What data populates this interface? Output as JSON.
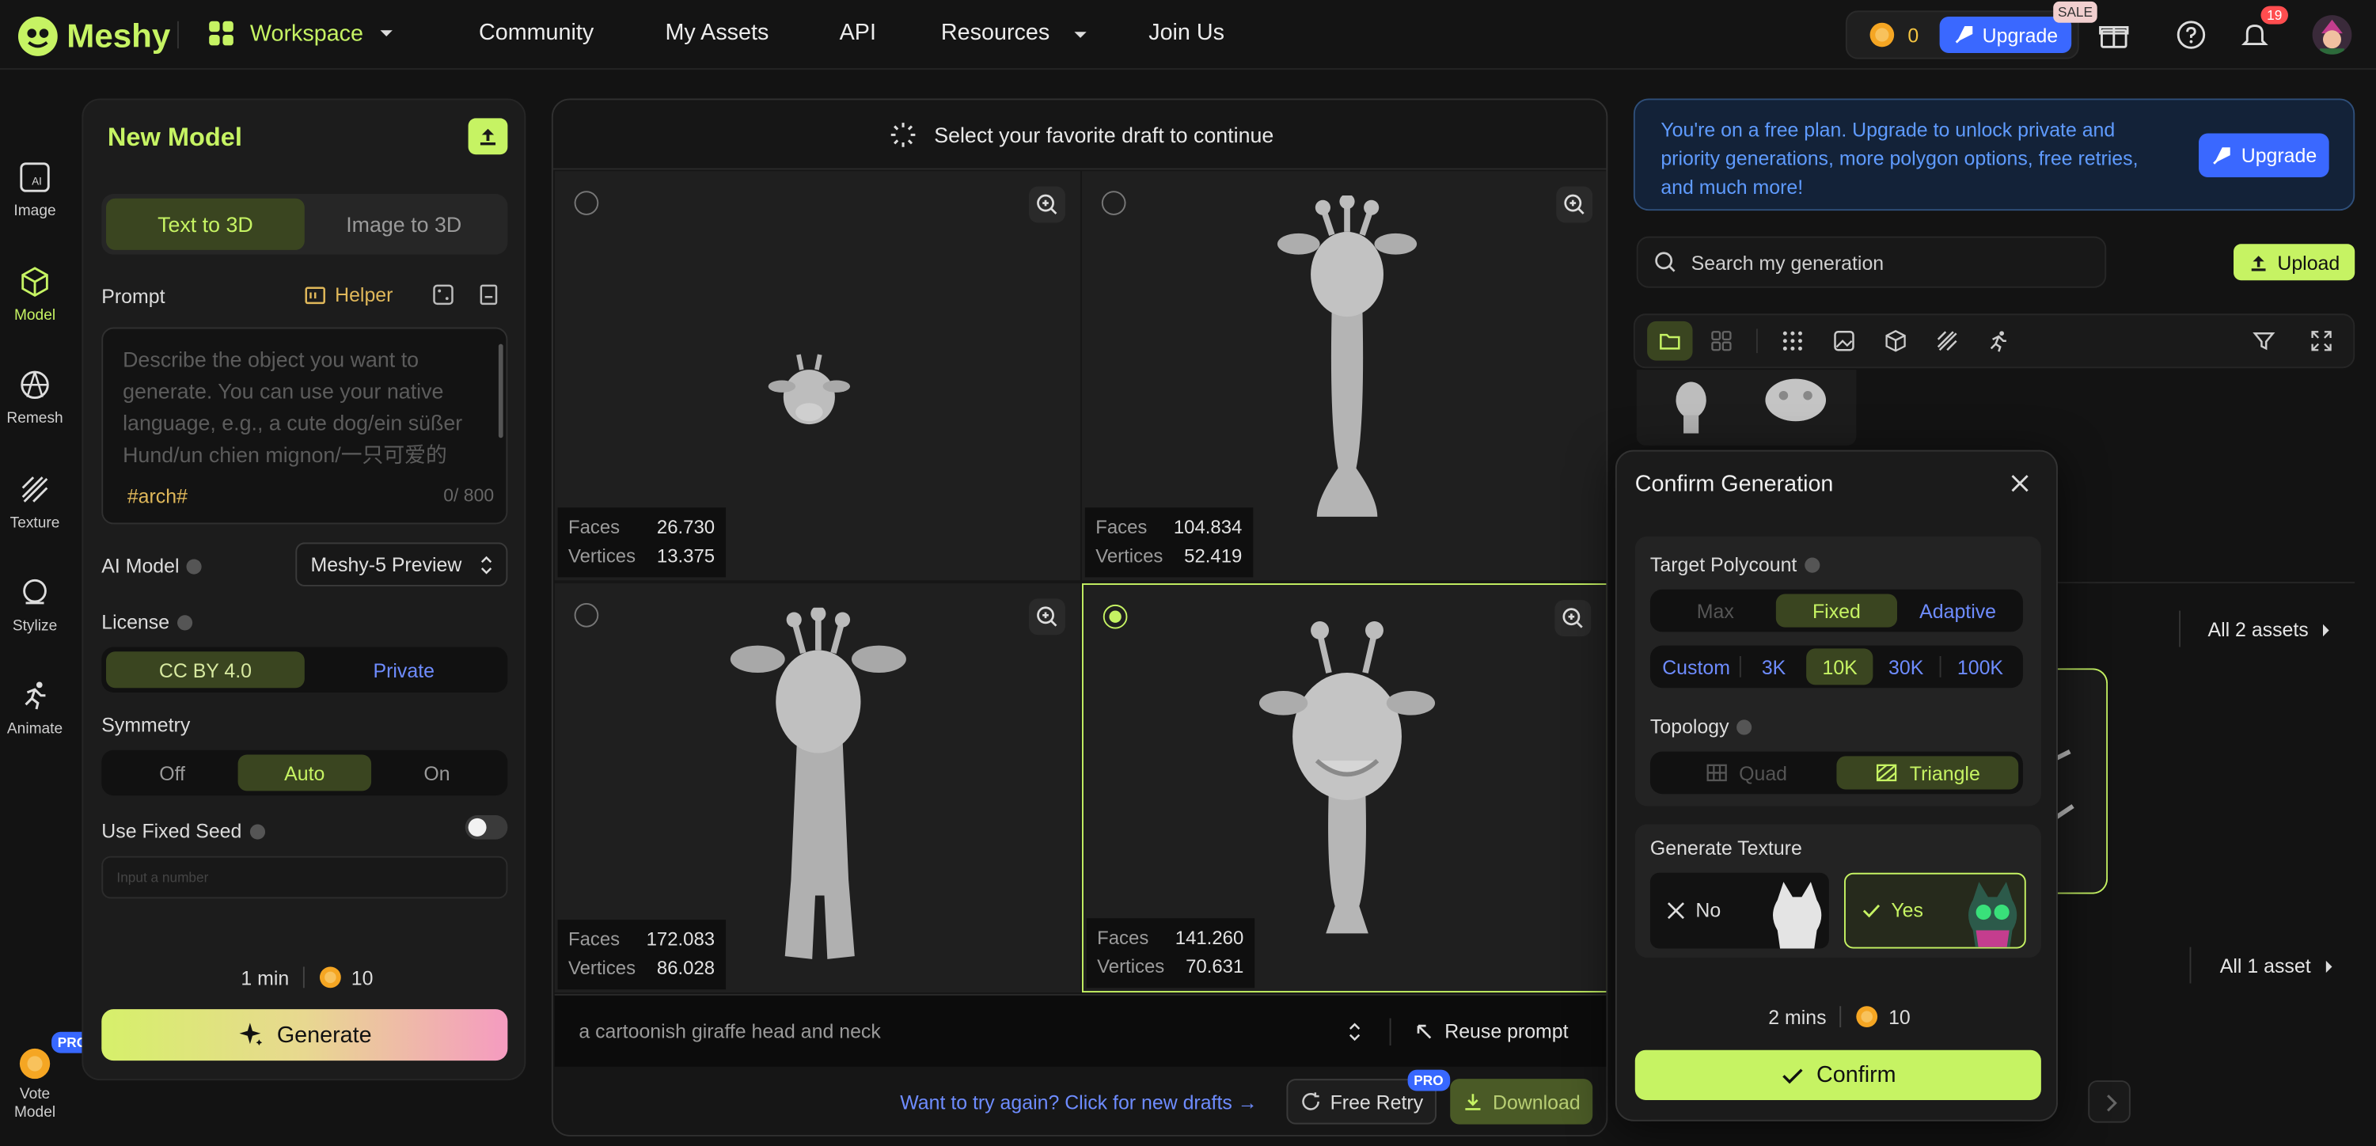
{
  "topbar": {
    "brand": "Meshy",
    "workspace": "Workspace",
    "nav": [
      "Community",
      "My Assets",
      "API",
      "Resources",
      "Join Us"
    ],
    "credits": "0",
    "upgrade": "Upgrade",
    "sale": "SALE",
    "notif_count": "19"
  },
  "sidebar": {
    "items": [
      "Image",
      "Model",
      "Remesh",
      "Texture",
      "Stylize",
      "Animate"
    ],
    "vote_line1": "Vote",
    "vote_line2": "Model",
    "pro": "PRO"
  },
  "left": {
    "title": "New Model",
    "tabs": [
      "Text to 3D",
      "Image to 3D"
    ],
    "prompt_label": "Prompt",
    "helper": "Helper",
    "placeholder": "Describe the object you want to generate. You can use your native language, e.g., a cute dog/ein süßer Hund/un chien mignon/一只可爱的",
    "tag": "#arch#",
    "count": "0/ 800",
    "ai_model_label": "AI Model",
    "ai_model_value": "Meshy-5 Preview",
    "license_label": "License",
    "license_options": [
      "CC BY 4.0",
      "Private"
    ],
    "symmetry_label": "Symmetry",
    "symmetry_options": [
      "Off",
      "Auto",
      "On"
    ],
    "seed_label": "Use Fixed Seed",
    "seed_placeholder": "Input a number",
    "time": "1 min",
    "cost": "10",
    "generate": "Generate"
  },
  "center": {
    "header": "Select your favorite draft to continue",
    "drafts": [
      {
        "faces": "26.730",
        "vertices": "13.375"
      },
      {
        "faces": "104.834",
        "vertices": "52.419"
      },
      {
        "faces": "172.083",
        "vertices": "86.028"
      },
      {
        "faces": "141.260",
        "vertices": "70.631"
      }
    ],
    "faces_label": "Faces",
    "vertices_label": "Vertices",
    "prompt_text": "a cartoonish giraffe head and neck",
    "reuse": "Reuse prompt",
    "try_again": "Want to try again? Click for new drafts →",
    "free_retry": "Free Retry",
    "pro": "PRO",
    "download": "Download"
  },
  "right": {
    "banner": "You're on a free plan. Upgrade to unlock private and priority generations, more polygon options, free retries, and much more!",
    "upgrade": "Upgrade",
    "search_placeholder": "Search my generation",
    "upload": "Upload",
    "all_assets_1": "All 2 assets",
    "all_assets_2": "All 1 asset"
  },
  "modal": {
    "title": "Confirm Generation",
    "polycount_label": "Target Polycount",
    "poly_modes": [
      "Max",
      "Fixed",
      "Adaptive"
    ],
    "poly_values": [
      "Custom",
      "3K",
      "10K",
      "30K",
      "100K"
    ],
    "topology_label": "Topology",
    "topology": [
      "Quad",
      "Triangle"
    ],
    "texture_label": "Generate Texture",
    "texture_no": "No",
    "texture_yes": "Yes",
    "time": "2 mins",
    "cost": "10",
    "confirm": "Confirm"
  }
}
